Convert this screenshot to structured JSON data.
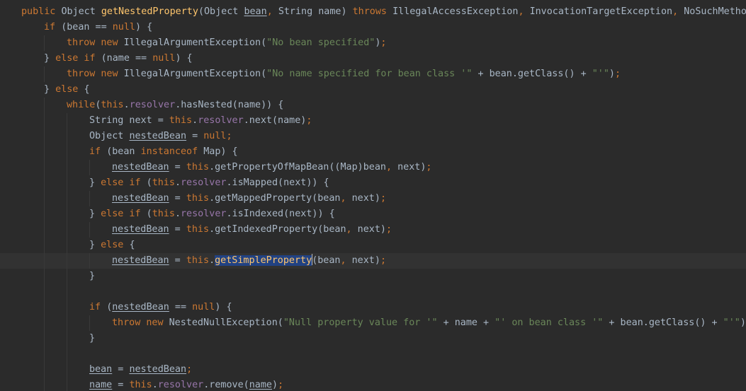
{
  "editor": {
    "lines": [
      {
        "indent": 0,
        "guides": 0,
        "tokens": [
          {
            "t": "public ",
            "c": "kw"
          },
          {
            "t": "Object ",
            "c": "pl"
          },
          {
            "t": "getNestedProperty",
            "c": "fn"
          },
          {
            "t": "(Object ",
            "c": "pl"
          },
          {
            "t": "bean",
            "c": "pl",
            "u": true
          },
          {
            "t": ", ",
            "c": "kw"
          },
          {
            "t": "String name) ",
            "c": "pl"
          },
          {
            "t": "throws ",
            "c": "kw"
          },
          {
            "t": "IllegalAccessException",
            "c": "pl"
          },
          {
            "t": ", ",
            "c": "kw"
          },
          {
            "t": "InvocationTargetException",
            "c": "pl"
          },
          {
            "t": ", ",
            "c": "kw"
          },
          {
            "t": "NoSuchMethod",
            "c": "pl"
          }
        ]
      },
      {
        "indent": 1,
        "guides": 0,
        "tokens": [
          {
            "t": "if ",
            "c": "kw"
          },
          {
            "t": "(bean == ",
            "c": "pl"
          },
          {
            "t": "null",
            "c": "kw"
          },
          {
            "t": ") {",
            "c": "pl"
          }
        ]
      },
      {
        "indent": 2,
        "guides": 1,
        "tokens": [
          {
            "t": "throw new ",
            "c": "kw"
          },
          {
            "t": "IllegalArgumentException(",
            "c": "pl"
          },
          {
            "t": "\"No bean specified\"",
            "c": "str"
          },
          {
            "t": ")",
            "c": "pl"
          },
          {
            "t": ";",
            "c": "kw"
          }
        ]
      },
      {
        "indent": 1,
        "guides": 0,
        "tokens": [
          {
            "t": "} ",
            "c": "pl"
          },
          {
            "t": "else if ",
            "c": "kw"
          },
          {
            "t": "(name == ",
            "c": "pl"
          },
          {
            "t": "null",
            "c": "kw"
          },
          {
            "t": ") {",
            "c": "pl"
          }
        ]
      },
      {
        "indent": 2,
        "guides": 1,
        "tokens": [
          {
            "t": "throw new ",
            "c": "kw"
          },
          {
            "t": "IllegalArgumentException(",
            "c": "pl"
          },
          {
            "t": "\"No name specified for bean class '\"",
            "c": "str"
          },
          {
            "t": " + bean.getClass() + ",
            "c": "pl"
          },
          {
            "t": "\"'\"",
            "c": "str"
          },
          {
            "t": ")",
            "c": "pl"
          },
          {
            "t": ";",
            "c": "kw"
          }
        ]
      },
      {
        "indent": 1,
        "guides": 0,
        "tokens": [
          {
            "t": "} ",
            "c": "pl"
          },
          {
            "t": "else ",
            "c": "kw"
          },
          {
            "t": "{",
            "c": "pl"
          }
        ]
      },
      {
        "indent": 2,
        "guides": 1,
        "tokens": [
          {
            "t": "while",
            "c": "kw"
          },
          {
            "t": "(",
            "c": "pl"
          },
          {
            "t": "this",
            "c": "kw"
          },
          {
            "t": ".",
            "c": "pl"
          },
          {
            "t": "resolver",
            "c": "fld"
          },
          {
            "t": ".hasNested(name)) {",
            "c": "pl"
          }
        ]
      },
      {
        "indent": 3,
        "guides": 2,
        "tokens": [
          {
            "t": "String next = ",
            "c": "pl"
          },
          {
            "t": "this",
            "c": "kw"
          },
          {
            "t": ".",
            "c": "pl"
          },
          {
            "t": "resolver",
            "c": "fld"
          },
          {
            "t": ".next(name)",
            "c": "pl"
          },
          {
            "t": ";",
            "c": "kw"
          }
        ]
      },
      {
        "indent": 3,
        "guides": 2,
        "tokens": [
          {
            "t": "Object ",
            "c": "pl"
          },
          {
            "t": "nestedBean",
            "c": "pl",
            "u": true
          },
          {
            "t": " = ",
            "c": "pl"
          },
          {
            "t": "null;",
            "c": "kw"
          }
        ]
      },
      {
        "indent": 3,
        "guides": 2,
        "tokens": [
          {
            "t": "if ",
            "c": "kw"
          },
          {
            "t": "(bean ",
            "c": "pl"
          },
          {
            "t": "instanceof ",
            "c": "kw"
          },
          {
            "t": "Map) {",
            "c": "pl"
          }
        ]
      },
      {
        "indent": 4,
        "guides": 3,
        "tokens": [
          {
            "t": "nestedBean",
            "c": "pl",
            "u": true
          },
          {
            "t": " = ",
            "c": "pl"
          },
          {
            "t": "this",
            "c": "kw"
          },
          {
            "t": ".getPropertyOfMapBean((Map)bean",
            "c": "pl"
          },
          {
            "t": ", ",
            "c": "kw"
          },
          {
            "t": "next)",
            "c": "pl"
          },
          {
            "t": ";",
            "c": "kw"
          }
        ]
      },
      {
        "indent": 3,
        "guides": 2,
        "tokens": [
          {
            "t": "} ",
            "c": "pl"
          },
          {
            "t": "else if ",
            "c": "kw"
          },
          {
            "t": "(",
            "c": "pl"
          },
          {
            "t": "this",
            "c": "kw"
          },
          {
            "t": ".",
            "c": "pl"
          },
          {
            "t": "resolver",
            "c": "fld"
          },
          {
            "t": ".isMapped(next)) {",
            "c": "pl"
          }
        ]
      },
      {
        "indent": 4,
        "guides": 3,
        "tokens": [
          {
            "t": "nestedBean",
            "c": "pl",
            "u": true
          },
          {
            "t": " = ",
            "c": "pl"
          },
          {
            "t": "this",
            "c": "kw"
          },
          {
            "t": ".getMappedProperty(bean",
            "c": "pl"
          },
          {
            "t": ", ",
            "c": "kw"
          },
          {
            "t": "next)",
            "c": "pl"
          },
          {
            "t": ";",
            "c": "kw"
          }
        ]
      },
      {
        "indent": 3,
        "guides": 2,
        "tokens": [
          {
            "t": "} ",
            "c": "pl"
          },
          {
            "t": "else if ",
            "c": "kw"
          },
          {
            "t": "(",
            "c": "pl"
          },
          {
            "t": "this",
            "c": "kw"
          },
          {
            "t": ".",
            "c": "pl"
          },
          {
            "t": "resolver",
            "c": "fld"
          },
          {
            "t": ".isIndexed(next)) {",
            "c": "pl"
          }
        ]
      },
      {
        "indent": 4,
        "guides": 3,
        "tokens": [
          {
            "t": "nestedBean",
            "c": "pl",
            "u": true
          },
          {
            "t": " = ",
            "c": "pl"
          },
          {
            "t": "this",
            "c": "kw"
          },
          {
            "t": ".getIndexedProperty(bean",
            "c": "pl"
          },
          {
            "t": ", ",
            "c": "kw"
          },
          {
            "t": "next)",
            "c": "pl"
          },
          {
            "t": ";",
            "c": "kw"
          }
        ]
      },
      {
        "indent": 3,
        "guides": 2,
        "tokens": [
          {
            "t": "} ",
            "c": "pl"
          },
          {
            "t": "else ",
            "c": "kw"
          },
          {
            "t": "{",
            "c": "pl"
          }
        ]
      },
      {
        "indent": 4,
        "guides": 3,
        "current": true,
        "tokens": [
          {
            "t": "nestedBean",
            "c": "pl",
            "u": true
          },
          {
            "t": " = ",
            "c": "pl"
          },
          {
            "t": "this",
            "c": "kw"
          },
          {
            "t": ".",
            "c": "pl"
          },
          {
            "t": "getSimpleProperty",
            "c": "fn",
            "sel": true
          },
          {
            "caret": true
          },
          {
            "t": "(bean",
            "c": "pl"
          },
          {
            "t": ", ",
            "c": "kw"
          },
          {
            "t": "next)",
            "c": "pl"
          },
          {
            "t": ";",
            "c": "kw"
          }
        ]
      },
      {
        "indent": 3,
        "guides": 2,
        "tokens": [
          {
            "t": "}",
            "c": "pl"
          }
        ]
      },
      {
        "indent": 0,
        "guides": 2,
        "tokens": []
      },
      {
        "indent": 3,
        "guides": 2,
        "tokens": [
          {
            "t": "if ",
            "c": "kw"
          },
          {
            "t": "(",
            "c": "pl"
          },
          {
            "t": "nestedBean",
            "c": "pl",
            "u": true
          },
          {
            "t": " == ",
            "c": "pl"
          },
          {
            "t": "null",
            "c": "kw"
          },
          {
            "t": ") {",
            "c": "pl"
          }
        ]
      },
      {
        "indent": 4,
        "guides": 3,
        "tokens": [
          {
            "t": "throw new ",
            "c": "kw"
          },
          {
            "t": "NestedNullException(",
            "c": "pl"
          },
          {
            "t": "\"Null property value for '\"",
            "c": "str"
          },
          {
            "t": " + name + ",
            "c": "pl"
          },
          {
            "t": "\"' on bean class '\"",
            "c": "str"
          },
          {
            "t": " + bean.getClass() + ",
            "c": "pl"
          },
          {
            "t": "\"'\"",
            "c": "str"
          },
          {
            "t": ")",
            "c": "pl"
          },
          {
            "t": ";",
            "c": "kw"
          }
        ]
      },
      {
        "indent": 3,
        "guides": 2,
        "tokens": [
          {
            "t": "}",
            "c": "pl"
          }
        ]
      },
      {
        "indent": 0,
        "guides": 2,
        "tokens": []
      },
      {
        "indent": 3,
        "guides": 2,
        "tokens": [
          {
            "t": "bean",
            "c": "pl",
            "u": true
          },
          {
            "t": " = ",
            "c": "pl"
          },
          {
            "t": "nestedBean",
            "c": "pl",
            "u": true
          },
          {
            "t": ";",
            "c": "kw"
          }
        ]
      },
      {
        "indent": 3,
        "guides": 2,
        "tokens": [
          {
            "t": "name",
            "c": "pl",
            "u": true
          },
          {
            "t": " = ",
            "c": "pl"
          },
          {
            "t": "this",
            "c": "kw"
          },
          {
            "t": ".",
            "c": "pl"
          },
          {
            "t": "resolver",
            "c": "fld"
          },
          {
            "t": ".remove(",
            "c": "pl"
          },
          {
            "t": "name",
            "c": "pl",
            "u": true
          },
          {
            "t": ")",
            "c": "pl"
          },
          {
            "t": ";",
            "c": "kw"
          }
        ]
      }
    ],
    "gutter_icon": "lightbulb-icon"
  }
}
